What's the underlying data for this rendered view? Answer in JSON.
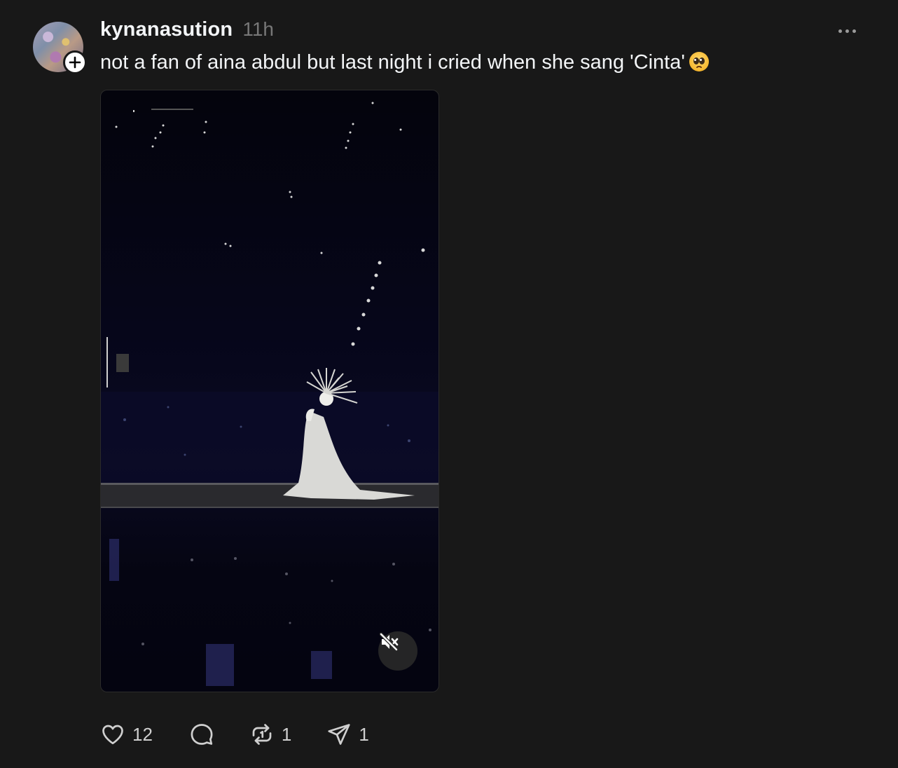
{
  "post": {
    "username": "kynanasution",
    "timestamp": "11h",
    "caption": "not a fan of aina abdul but last night i cried when she sang 'Cinta'",
    "caption_emoji": "pleading-face-emoji",
    "media": {
      "type": "video",
      "muted": true,
      "mute_icon": "speaker-muted-icon"
    },
    "actions": {
      "like_count": "12",
      "reply_count": "",
      "repost_count": "1",
      "share_count": "1"
    }
  },
  "colors": {
    "background": "#181818",
    "text_primary": "#f3f5f7",
    "text_secondary": "#777777",
    "icon": "#cfcfcf"
  }
}
